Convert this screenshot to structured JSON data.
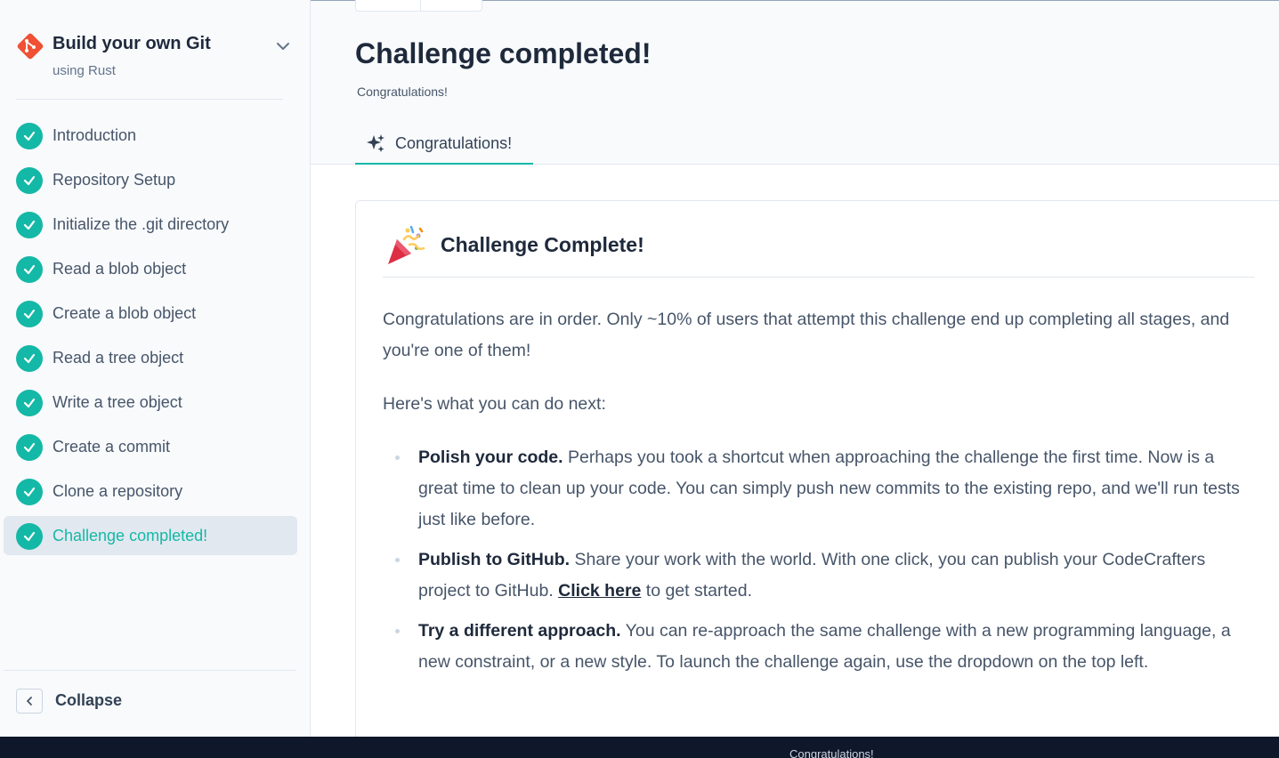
{
  "sidebar": {
    "title": "Build your own Git",
    "subtitle": "using Rust",
    "stages": [
      {
        "label": "Introduction",
        "active": false
      },
      {
        "label": "Repository Setup",
        "active": false
      },
      {
        "label": "Initialize the .git directory",
        "active": false
      },
      {
        "label": "Read a blob object",
        "active": false
      },
      {
        "label": "Create a blob object",
        "active": false
      },
      {
        "label": "Read a tree object",
        "active": false
      },
      {
        "label": "Write a tree object",
        "active": false
      },
      {
        "label": "Create a commit",
        "active": false
      },
      {
        "label": "Clone a repository",
        "active": false
      },
      {
        "label": "Challenge completed!",
        "active": true
      }
    ],
    "collapse_label": "Collapse"
  },
  "main": {
    "title": "Challenge completed!",
    "subtitle": "Congratulations!",
    "tab_label": "Congratulations!",
    "card": {
      "title": "Challenge Complete!",
      "intro": "Congratulations are in order. Only ~10% of users that attempt this challenge end up completing all stages, and you're one of them!",
      "next_heading": "Here's what you can do next:",
      "items": [
        {
          "bold": "Polish your code.",
          "text": " Perhaps you took a shortcut when approaching the challenge the first time. Now is a great time to clean up your code. You can simply push new commits to the existing repo, and we'll run tests just like before."
        },
        {
          "bold": "Publish to GitHub.",
          "text": " Share your work with the world. With one click, you can publish your CodeCrafters project to GitHub. ",
          "link": "Click here",
          "after": " to get started."
        },
        {
          "bold": "Try a different approach.",
          "text": " You can re-approach the same challenge with a new programming language, a new constraint, or a new style. To launch the challenge again, use the dropdown on the top left."
        }
      ]
    }
  },
  "bottom_bar": {
    "text": "Congratulations!"
  },
  "colors": {
    "accent": "#14b8a6",
    "git_logo": "#f05033",
    "bottom_bar": "#0f172a"
  },
  "icons": [
    "git-logo-icon",
    "chevron-down-icon",
    "check-icon",
    "chevron-left-icon",
    "sparkle-icon",
    "party-popper-icon"
  ]
}
